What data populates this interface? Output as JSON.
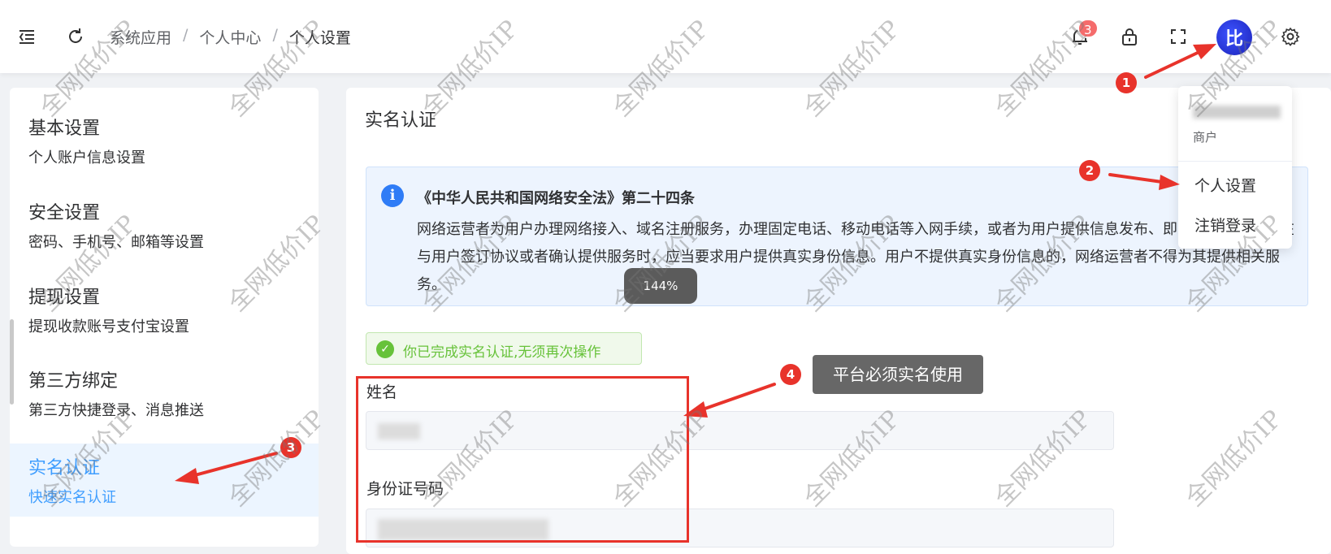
{
  "header": {
    "breadcrumb": [
      "系统应用",
      "个人中心",
      "个人设置"
    ],
    "breadcrumb_separator": "/",
    "notification_count": "3",
    "avatar_text": "比"
  },
  "sidebar": {
    "items": [
      {
        "title": "基本设置",
        "desc": "个人账户信息设置"
      },
      {
        "title": "安全设置",
        "desc": "密码、手机号、邮箱等设置"
      },
      {
        "title": "提现设置",
        "desc": "提现收款账号支付宝设置"
      },
      {
        "title": "第三方绑定",
        "desc": "第三方快捷登录、消息推送"
      },
      {
        "title": "实名认证",
        "desc": "快速实名认证"
      }
    ],
    "active_index": 4
  },
  "main": {
    "title": "实名认证",
    "alert_title": "《中华人民共和国网络安全法》第二十四条",
    "alert_body": "网络运营者为用户办理网络接入、域名注册服务，办理固定电话、移动电话等入网手续，或者为用户提供信息发布、即时通讯等服务，在与用户签订协议或者确认提供服务时，应当要求用户提供真实身份信息。用户不提供真实身份信息的，网络运营者不得为其提供相关服务。",
    "success_text": "你已完成实名认证,无须再次操作",
    "name_label": "姓名",
    "id_label": "身份证号码"
  },
  "zoom": "144%",
  "dropdown": {
    "role": "商户",
    "items": [
      "个人设置",
      "注销登录"
    ]
  },
  "annotations": {
    "callouts": [
      "1",
      "2",
      "3",
      "4"
    ],
    "tip": "平台必须实名使用"
  },
  "watermark": "全网低价IP",
  "colors": {
    "primary": "#409eff",
    "danger": "#f56c6c",
    "success": "#67c23a",
    "annotation_red": "#e8332b"
  }
}
